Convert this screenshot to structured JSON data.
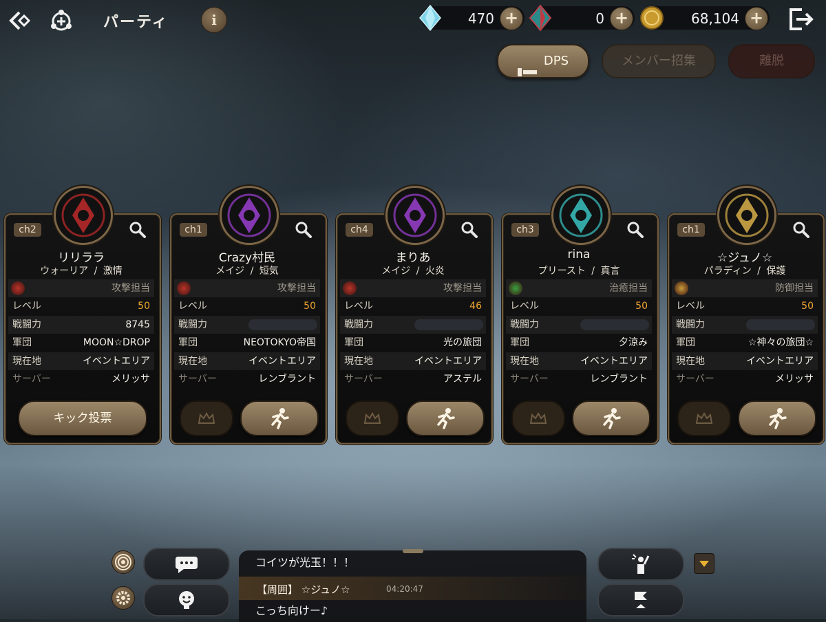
{
  "header": {
    "title": "パーティ",
    "info_label": "i",
    "currencies": [
      {
        "icon": "blue-crystal-icon",
        "value": "470",
        "plus": "+"
      },
      {
        "icon": "red-crystal-icon",
        "value": "0",
        "plus": "+"
      },
      {
        "icon": "gold-coin-icon",
        "value": "68,104",
        "plus": "+"
      }
    ]
  },
  "actions": {
    "dps_label": "DPS",
    "recruit_label": "メンバー招集",
    "leave_label": "離脱"
  },
  "row_labels": {
    "level": "レベル",
    "power": "戦闘力",
    "guild": "軍団",
    "location": "現在地",
    "server": "サーバー"
  },
  "members": [
    {
      "channel": "ch2",
      "name": "リリララ",
      "class": "ウォーリア",
      "sep": "/",
      "trait": "激情",
      "role": "攻撃担当",
      "role_color": "#b8342a",
      "level": "50",
      "power": "8745",
      "guild": "MOON☆DROP",
      "location": "イベントエリア",
      "server": "メリッサ",
      "kick_label": "キック投票",
      "emblem_color": "#c02a2a"
    },
    {
      "channel": "ch1",
      "name": "Crazy村民",
      "class": "メイジ",
      "sep": "/",
      "trait": "短気",
      "role": "攻撃担当",
      "role_color": "#b8342a",
      "level": "50",
      "power": "",
      "guild": "NEOTOKYO帝国",
      "location": "イベントエリア",
      "server": "レンブラント",
      "emblem_color": "#9b3fd0"
    },
    {
      "channel": "ch4",
      "name": "まりあ",
      "class": "メイジ",
      "sep": "/",
      "trait": "火炎",
      "role": "攻撃担当",
      "role_color": "#b8342a",
      "level": "46",
      "power": "",
      "guild": "光の旅団",
      "location": "イベントエリア",
      "server": "アステル",
      "emblem_color": "#9b3fd0"
    },
    {
      "channel": "ch3",
      "name": "rina",
      "class": "プリースト",
      "sep": "/",
      "trait": "真言",
      "role": "治癒担当",
      "role_color": "#3aa040",
      "level": "50",
      "power": "",
      "guild": "夕涼み",
      "location": "イベントエリア",
      "server": "レンブラント",
      "emblem_color": "#39c2c0"
    },
    {
      "channel": "ch1",
      "name": "☆ジュノ☆",
      "class": "パラディン",
      "sep": "/",
      "trait": "保護",
      "role": "防御担当",
      "role_color": "#c89a3a",
      "level": "50",
      "power": "",
      "guild": "☆神々の旅団☆",
      "location": "イベントエリア",
      "server": "メリッサ",
      "emblem_color": "#d8b04a"
    }
  ],
  "chat": {
    "line1": "コイツが光玉！！！",
    "line2_prefix": "【周囲】 ☆ジュノ☆",
    "line2_time": "04:20:47",
    "line3": "こっち向けー♪"
  }
}
